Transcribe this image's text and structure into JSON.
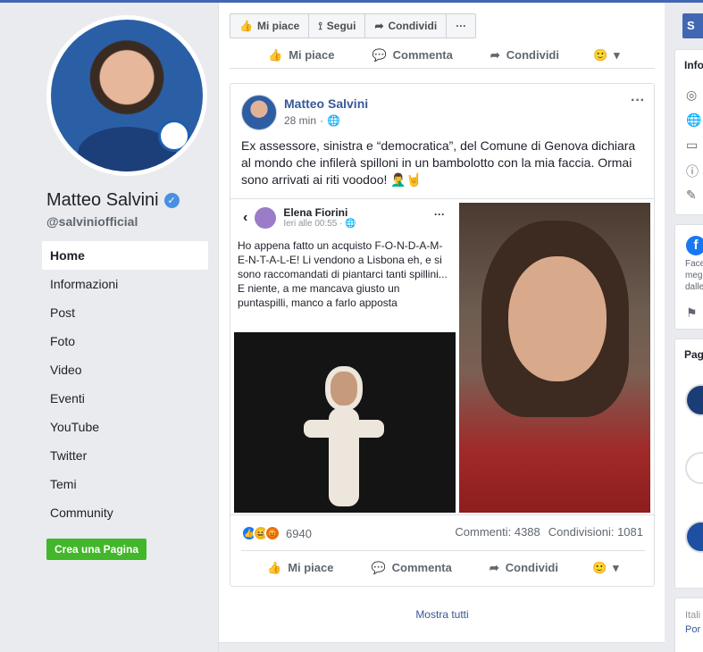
{
  "page": {
    "name": "Matteo Salvini",
    "handle": "@salviniofficial",
    "nav": [
      {
        "label": "Home",
        "active": true
      },
      {
        "label": "Informazioni"
      },
      {
        "label": "Post"
      },
      {
        "label": "Foto"
      },
      {
        "label": "Video"
      },
      {
        "label": "Eventi"
      },
      {
        "label": "YouTube"
      },
      {
        "label": "Twitter"
      },
      {
        "label": "Temi"
      },
      {
        "label": "Community"
      }
    ],
    "create_page_label": "Crea una Pagina"
  },
  "action_bar": {
    "like": "Mi piace",
    "follow": "Segui",
    "share": "Condividi",
    "more": "···"
  },
  "prev_post": {
    "like": "Mi piace",
    "comment": "Commenta",
    "share": "Condividi"
  },
  "post": {
    "author": "Matteo Salvini",
    "time": "28 min",
    "text": "Ex assessore, sinistra e “democratica”, del Comune di Genova dichiara al mondo che infilerà spilloni in un bambolotto con la mia faccia. Ormai sono arrivati ai riti voodoo! 🤦‍♂️🤘",
    "screenshot": {
      "author": "Elena Fiorini",
      "time": "Ieri alle 00:55 · ",
      "text": "Ho appena fatto un acquisto F-O-N-D-A-M-E-N-T-A-L-E! Li vendono a Lisbona eh, e si sono raccomandati di piantarci tanti spillini... E niente, a me mancava giusto un puntaspilli, manco a farlo apposta"
    },
    "reactions_count": "6940",
    "comments": "Commenti: 4388",
    "shares": "Condivisioni: 1081",
    "actions": {
      "like": "Mi piace",
      "comment": "Commenta",
      "share": "Condividi"
    }
  },
  "show_all": "Mostra tutti",
  "right": {
    "button_letter": "S",
    "info_title": "Info",
    "fb_text": [
      "Face",
      "meg",
      "dalle"
    ],
    "pages_title": "Pag",
    "footer": [
      "Itali",
      "Por"
    ]
  },
  "colors": {
    "facebook_blue": "#4267b2",
    "link_blue": "#385898",
    "green": "#42b72a",
    "background": "#e9ebee"
  }
}
